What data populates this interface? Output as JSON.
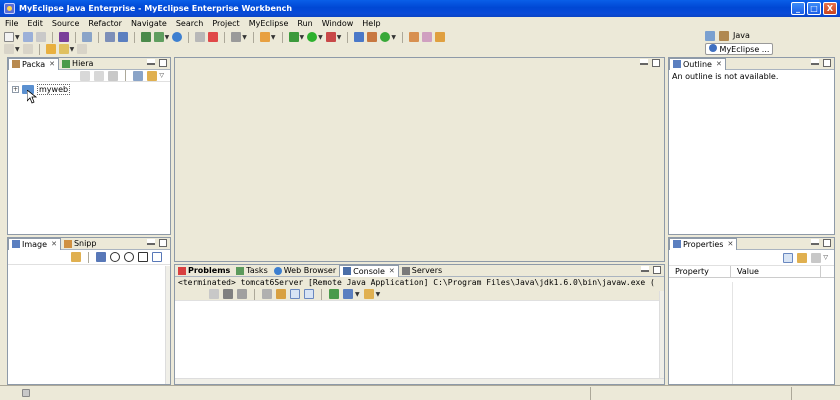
{
  "window": {
    "title": "MyEclipse Java Enterprise - MyEclipse Enterprise Workbench",
    "controls": {
      "minimize": "_",
      "maximize": "□",
      "close": "X"
    }
  },
  "menu": [
    "File",
    "Edit",
    "Source",
    "Refactor",
    "Navigate",
    "Search",
    "Project",
    "MyEclipse",
    "Run",
    "Window",
    "Help"
  ],
  "perspectives": {
    "java": "Java",
    "myeclipse": "MyEclipse ..."
  },
  "left_top": {
    "tabs": [
      "Packa",
      "Hiera"
    ],
    "tree": [
      {
        "label": "myweb",
        "expander": "+"
      }
    ]
  },
  "left_bottom": {
    "tabs": [
      "Image",
      "Snipp"
    ]
  },
  "outline": {
    "tab": "Outline",
    "message": "An outline is not available."
  },
  "properties": {
    "tab": "Properties",
    "columns": [
      "Property",
      "Value"
    ]
  },
  "bottom": {
    "tabs": [
      "Problems",
      "Tasks",
      "Web Browser",
      "Console",
      "Servers"
    ],
    "console_line": "<terminated> tomcat6Server [Remote Java Application] C:\\Program Files\\Java\\jdk1.6.0\\bin\\javaw.exe ("
  },
  "colors": {
    "titlebar": "#0A4BD8",
    "chrome": "#ECE9D8",
    "panel_border": "#8e9aa8"
  }
}
